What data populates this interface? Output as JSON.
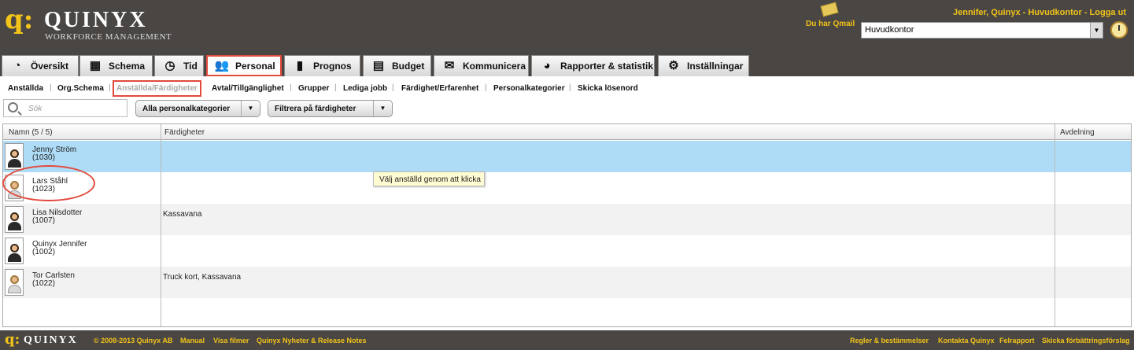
{
  "brand": {
    "mark": "q:",
    "name": "QUINYX",
    "sub": "WORKFORCE MANAGEMENT",
    "footer_name": "QUINYX"
  },
  "user": {
    "line": "Jennifer, Quinyx  -  Huvudkontor  -  Logga ut"
  },
  "qmail": {
    "label": "Du har Qmail",
    "icon": "envelope-icon"
  },
  "unit": {
    "selected": "Huvudkontor"
  },
  "tabs": [
    {
      "label": "Översikt",
      "icon": "speedometer-icon"
    },
    {
      "label": "Schema",
      "icon": "calendar-icon"
    },
    {
      "label": "Tid",
      "icon": "clock-icon"
    },
    {
      "label": "Personal",
      "icon": "people-icon",
      "active": true
    },
    {
      "label": "Prognos",
      "icon": "bar-chart-icon"
    },
    {
      "label": "Budget",
      "icon": "calculator-icon"
    },
    {
      "label": "Kommunicera",
      "icon": "speech-bubble-icon"
    },
    {
      "label": "Rapporter & statistik",
      "icon": "report-icon"
    },
    {
      "label": "Inställningar",
      "icon": "gear-icon"
    }
  ],
  "subnav": [
    {
      "label": "Anställda"
    },
    {
      "label": "Org.Schema"
    },
    {
      "label": "Anställda/Färdigheter",
      "active": true
    },
    {
      "label": "Avtal/Tillgänglighet"
    },
    {
      "label": "Grupper"
    },
    {
      "label": "Lediga jobb"
    },
    {
      "label": "Färdighet/Erfarenhet"
    },
    {
      "label": "Personalkategorier"
    },
    {
      "label": "Skicka lösenord"
    }
  ],
  "search": {
    "placeholder": "Sök"
  },
  "filters": {
    "category": "Alla personalkategorier",
    "skills": "Filtrera på färdigheter"
  },
  "grid": {
    "headers": {
      "name": "Namn (5 / 5)",
      "skills": "Färdigheter",
      "dept": "Avdelning"
    },
    "rows": [
      {
        "name": "Jenny Ström",
        "id": "(1030)",
        "skills": "",
        "selected": true
      },
      {
        "name": "Lars Ståhl",
        "id": "(1023)",
        "skills": ""
      },
      {
        "name": "Lisa Nilsdotter",
        "id": "(1007)",
        "skills": "Kassavana"
      },
      {
        "name": "Quinyx Jennifer",
        "id": "(1002)",
        "skills": ""
      },
      {
        "name": "Tor Carlsten",
        "id": "(1022)",
        "skills": "Truck kort, Kassavana"
      }
    ]
  },
  "tooltip": {
    "text": "Välj anställd genom att klicka"
  },
  "footer": {
    "copyright": "© 2008-2013 Quinyx AB",
    "manual": "Manual",
    "films": "Visa filmer",
    "news": "Quinyx Nyheter & Release Notes",
    "rules": "Regler & bestämmelser",
    "contact": "Kontakta Quinyx",
    "bug": "Felrapport",
    "suggest": "Skicka förbättringsförslag"
  }
}
